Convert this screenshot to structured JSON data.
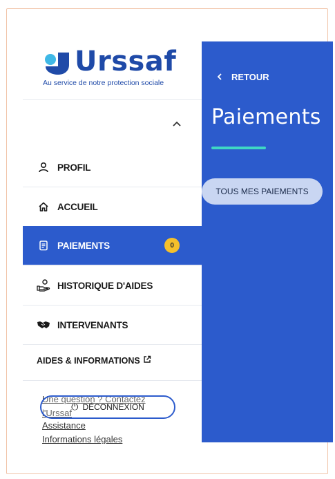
{
  "brand": {
    "name": "Urssaf",
    "tagline": "Au service de notre protection sociale",
    "colors": {
      "primary": "#2c5bcc",
      "logo_blue": "#1f4aa8",
      "logo_cyan": "#3fb8e6",
      "accent": "#3fd8c4",
      "badge": "#f5c02b"
    }
  },
  "sidebar": {
    "collapse_icon": "chevron-up-icon",
    "items": [
      {
        "label": "PROFIL",
        "icon": "person-icon"
      },
      {
        "label": "ACCUEIL",
        "icon": "home-icon"
      },
      {
        "label": "PAIEMENTS",
        "icon": "document-icon",
        "active": true,
        "badge": "0"
      },
      {
        "label": "HISTORIQUE D'AIDES",
        "icon": "hand-coin-icon"
      },
      {
        "label": "INTERVENANTS",
        "icon": "handshake-icon"
      }
    ],
    "aides_label": "AIDES & INFORMATIONS",
    "footer_links": [
      "Une question ? Contactez l'Urssaf",
      "Assistance",
      "Informations légales"
    ],
    "logout_label": "DÉCONNEXION"
  },
  "panel": {
    "back_label": "RETOUR",
    "title": "Paiements",
    "submenu": [
      "TOUS MES PAIEMENTS"
    ]
  }
}
